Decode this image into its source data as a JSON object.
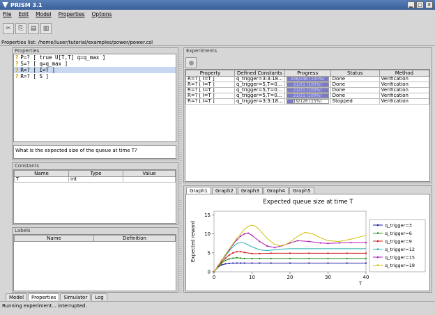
{
  "window": {
    "title": "PRISM 3.1"
  },
  "menu": [
    "File",
    "Edit",
    "Model",
    "Properties",
    "Options"
  ],
  "toolbar": [
    {
      "icon": "scissors-icon",
      "glyph": "✂"
    },
    {
      "icon": "copy-icon",
      "glyph": "⎘"
    },
    {
      "icon": "paste-icon",
      "glyph": "📋"
    },
    {
      "icon": "delete-icon",
      "glyph": "🗑"
    }
  ],
  "properties_list": {
    "label": "Properties list: /home/luser/tutorial/examples/power/power.csl"
  },
  "properties_panel": {
    "title": "Properties",
    "items": [
      {
        "text": "P=? [ true U[T,T] q=q_max ]",
        "selected": false
      },
      {
        "text": "S=? [ q=q_max ]",
        "selected": false
      },
      {
        "text": "R=? [ I=T ]",
        "selected": true
      },
      {
        "text": "R=? [ S ]",
        "selected": false
      }
    ],
    "description": "What is the expected size of the queue at time T?"
  },
  "constants_panel": {
    "title": "Constants",
    "headers": [
      "Name",
      "Type",
      "Value"
    ],
    "rows": [
      [
        "T",
        "int",
        ""
      ]
    ]
  },
  "labels_panel": {
    "title": "Labels",
    "headers": [
      "Name",
      "Definition"
    ]
  },
  "experiments_panel": {
    "title": "Experiments",
    "headers": [
      "Property",
      "Defined Constants",
      "Progress",
      "Status",
      "Method"
    ],
    "rows": [
      {
        "property": "R=? [ I=T ]",
        "constants": "q_trigger=3:3:18...",
        "progress": 1.0,
        "progress_text": "246/246 (100%)",
        "status": "Done",
        "method": "Verification"
      },
      {
        "property": "R=? [ I=T ]",
        "constants": "q_trigger=5,T=0...",
        "progress": 1.0,
        "progress_text": "21/21 (100%)",
        "status": "Done",
        "method": "Verification"
      },
      {
        "property": "R=? [ I=T ]",
        "constants": "q_trigger=5,T=0...",
        "progress": 1.0,
        "progress_text": "21/21 (100%)",
        "status": "Done",
        "method": "Verification"
      },
      {
        "property": "R=? [ I=T ]",
        "constants": "q_trigger=5,T=0...",
        "progress": 1.0,
        "progress_text": "21/21 (100%)",
        "status": "Done",
        "method": "Verification"
      },
      {
        "property": "R=? [ I=T ]",
        "constants": "q_trigger=3:3:18...",
        "progress": 0.15,
        "progress_text": "19/126 (15%)",
        "status": "Stopped",
        "method": "Verification"
      }
    ]
  },
  "graph_tabs": [
    "Graph1",
    "Graph2",
    "Graph3",
    "Graph4",
    "Graph5"
  ],
  "bottom_tabs": [
    "Model",
    "Properties",
    "Simulator",
    "Log"
  ],
  "status": "Running experiment... interrupted.",
  "chart_data": {
    "type": "line",
    "title": "Expected queue size at time T",
    "xlabel": "T",
    "ylabel": "Expected reward",
    "xlim": [
      0,
      40
    ],
    "ylim": [
      0,
      16
    ],
    "xticks": [
      0,
      10,
      20,
      30,
      40
    ],
    "yticks": [
      0,
      5,
      10,
      15
    ],
    "legend": "right",
    "series": [
      {
        "name": "q_trigger=3",
        "color": "#1a1aa0",
        "marker": "dot",
        "x": [
          0,
          1,
          2,
          3,
          4,
          5,
          6,
          7,
          8,
          10,
          12,
          15,
          20,
          25,
          30,
          35,
          40
        ],
        "y": [
          0,
          1.2,
          1.8,
          2.1,
          2.2,
          2.3,
          2.3,
          2.3,
          2.3,
          2.3,
          2.3,
          2.3,
          2.3,
          2.3,
          2.3,
          2.3,
          2.3
        ]
      },
      {
        "name": "q_trigger=6",
        "color": "#1a8a1a",
        "marker": "dot",
        "x": [
          0,
          1,
          2,
          3,
          4,
          5,
          6,
          7,
          8,
          10,
          12,
          15,
          20,
          25,
          30,
          35,
          40
        ],
        "y": [
          0,
          1.3,
          2.3,
          3.0,
          3.4,
          3.6,
          3.7,
          3.6,
          3.5,
          3.5,
          3.5,
          3.5,
          3.5,
          3.5,
          3.5,
          3.5,
          3.5
        ]
      },
      {
        "name": "q_trigger=9",
        "color": "#cc1a1a",
        "marker": "dot",
        "x": [
          0,
          1,
          2,
          3,
          4,
          5,
          6,
          7,
          8,
          10,
          12,
          15,
          20,
          25,
          30,
          35,
          40
        ],
        "y": [
          0,
          1.4,
          2.6,
          3.6,
          4.4,
          5.0,
          5.3,
          5.3,
          5.1,
          4.8,
          4.8,
          4.9,
          4.9,
          4.9,
          4.9,
          4.9,
          4.9
        ]
      },
      {
        "name": "q_trigger=12",
        "color": "#1ab0b0",
        "marker": "none",
        "x": [
          0,
          1,
          2,
          3,
          4,
          5,
          6,
          7,
          8,
          10,
          12,
          14,
          16,
          18,
          20,
          25,
          30,
          35,
          40
        ],
        "y": [
          0,
          1.5,
          2.9,
          4.2,
          5.5,
          6.6,
          7.4,
          7.8,
          7.6,
          6.6,
          5.8,
          5.6,
          5.8,
          6.0,
          6.1,
          6.1,
          6.1,
          6.1,
          6.1
        ]
      },
      {
        "name": "q_trigger=15",
        "color": "#b01ab0",
        "marker": "dot",
        "x": [
          0,
          1,
          2,
          3,
          4,
          5,
          6,
          7,
          8,
          9,
          10,
          12,
          14,
          16,
          18,
          20,
          22,
          25,
          28,
          30,
          33,
          36,
          40
        ],
        "y": [
          0,
          1.5,
          3.0,
          4.4,
          5.8,
          7.2,
          8.4,
          9.4,
          10.0,
          10.2,
          9.6,
          8.0,
          6.8,
          6.4,
          6.9,
          7.6,
          8.2,
          8.0,
          7.6,
          7.5,
          7.6,
          7.7,
          7.7
        ]
      },
      {
        "name": "q_trigger=18",
        "color": "#d0c000",
        "marker": "none",
        "x": [
          0,
          1,
          2,
          3,
          4,
          5,
          6,
          7,
          8,
          9,
          10,
          11,
          12,
          14,
          16,
          18,
          20,
          22,
          24,
          26,
          28,
          30,
          33,
          36,
          40
        ],
        "y": [
          0,
          1.5,
          3.0,
          4.5,
          6.0,
          7.4,
          8.8,
          10.0,
          11.2,
          12.0,
          12.3,
          12.0,
          11.0,
          8.8,
          7.2,
          6.8,
          7.8,
          9.4,
          10.4,
          10.0,
          9.0,
          8.2,
          8.0,
          8.6,
          9.6
        ]
      }
    ]
  }
}
